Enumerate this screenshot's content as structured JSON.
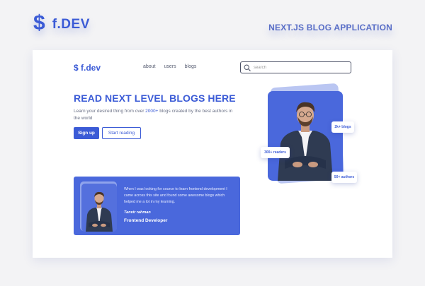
{
  "showcase": {
    "brand_symbol": "$",
    "brand_name": "f.DEV",
    "title": "NEXT.JS BLOG APPLICATION"
  },
  "navbar": {
    "logo": "$ f.dev",
    "links": [
      {
        "label": "about"
      },
      {
        "label": "users"
      },
      {
        "label": "blogs"
      }
    ],
    "search": {
      "placeholder": "search",
      "value": "",
      "icon": "search-icon"
    }
  },
  "hero": {
    "title": "READ NEXT LEVEL BLOGS HERE",
    "desc_before": "Learn your desired thing from over ",
    "desc_highlight": "2000+",
    "desc_after": " blogs created by the best authors in the world",
    "signup_label": "Sign up",
    "start_reading_label": "Start reading",
    "badges": {
      "blogs": "2k+ blogs",
      "readers": "300+ readers",
      "authors": "50+ authors"
    }
  },
  "testimonial": {
    "quote": "When I was looking for source to learn frontend development I came across this site and found some awesome blogs which helped me a lot in my learning.",
    "name": "Tanvir rahman",
    "role": "Frontend Developer"
  },
  "colors": {
    "accent": "#3b5bd6",
    "card": "#4a68dc",
    "page_bg": "#f3f3f5"
  }
}
